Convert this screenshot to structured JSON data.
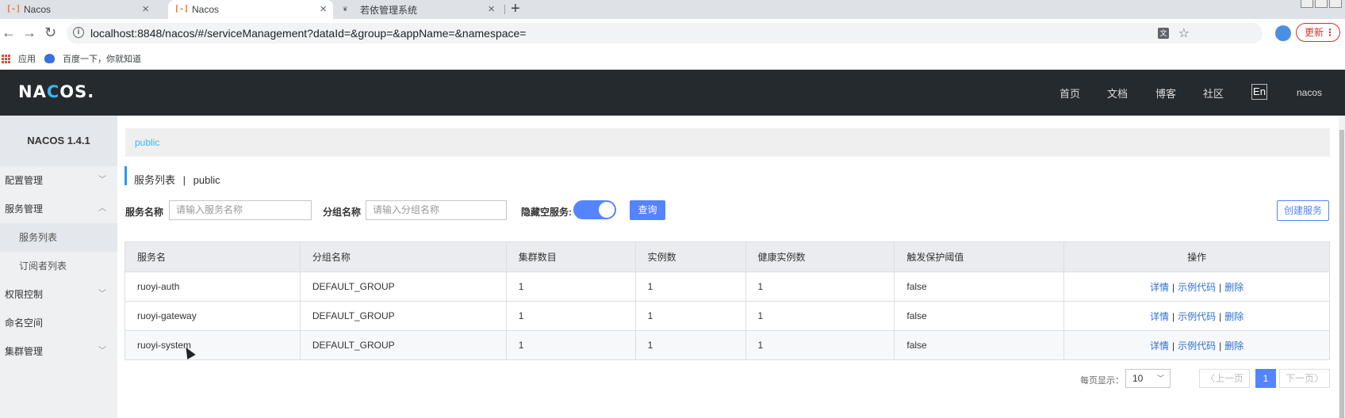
{
  "browser": {
    "tabs": [
      {
        "title": "Nacos"
      },
      {
        "title": "Nacos"
      },
      {
        "title": "若依管理系统"
      }
    ],
    "url": "localhost:8848/nacos/#/serviceManagement?dataId=&group=&appName=&namespace=",
    "update_label": "更新",
    "bookmarks": [
      {
        "label": "应用"
      },
      {
        "label": "百度一下，你就知道"
      }
    ]
  },
  "header": {
    "logo": "NACOS.",
    "nav": [
      "首页",
      "文档",
      "博客",
      "社区"
    ],
    "lang": "En",
    "user": "nacos"
  },
  "sidebar": {
    "title": "NACOS 1.4.1",
    "items": [
      {
        "label": "配置管理"
      },
      {
        "label": "服务管理"
      },
      {
        "label": "服务列表"
      },
      {
        "label": "订阅者列表"
      },
      {
        "label": "权限控制"
      },
      {
        "label": "命名空间"
      },
      {
        "label": "集群管理"
      }
    ]
  },
  "main": {
    "namespace_tab": "public",
    "title": "服务列表",
    "title_sep": "|",
    "title_ns": "public",
    "filters": {
      "service_name_label": "服务名称",
      "service_name_placeholder": "请输入服务名称",
      "group_name_label": "分组名称",
      "group_name_placeholder": "请输入分组名称",
      "hide_empty_label": "隐藏空服务:",
      "hide_empty_on": true,
      "query_label": "查询"
    },
    "create_label": "创建服务",
    "table": {
      "columns": [
        "服务名",
        "分组名称",
        "集群数目",
        "实例数",
        "健康实例数",
        "触发保护阈值",
        "操作"
      ],
      "rows": [
        {
          "name": "ruoyi-auth",
          "group": "DEFAULT_GROUP",
          "clusters": "1",
          "instances": "1",
          "healthy": "1",
          "threshold": "false"
        },
        {
          "name": "ruoyi-gateway",
          "group": "DEFAULT_GROUP",
          "clusters": "1",
          "instances": "1",
          "healthy": "1",
          "threshold": "false"
        },
        {
          "name": "ruoyi-system",
          "group": "DEFAULT_GROUP",
          "clusters": "1",
          "instances": "1",
          "healthy": "1",
          "threshold": "false"
        }
      ],
      "actions": {
        "detail": "详情",
        "sample": "示例代码",
        "delete": "删除",
        "sep": "|"
      }
    },
    "pagination": {
      "per_page_label": "每页显示：",
      "per_page_value": "10",
      "prev_label": "上一页",
      "current_page": "1",
      "next_label": "下一页"
    }
  },
  "colors": {
    "header_bg": "#252a2f",
    "accent": "#5584ff",
    "link": "#2f6fcf"
  }
}
